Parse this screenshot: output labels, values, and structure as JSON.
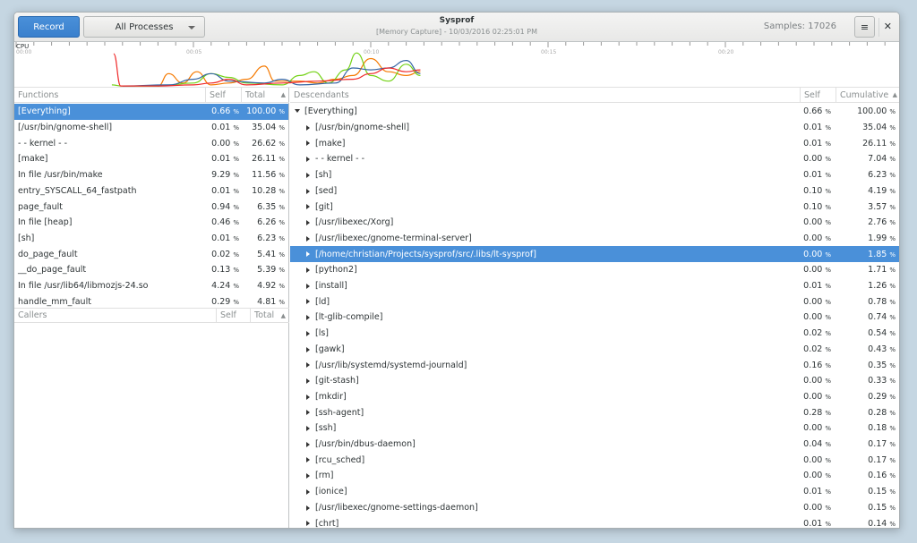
{
  "header": {
    "record_label": "Record",
    "process_selector": "All Processes",
    "title": "Sysprof",
    "subtitle": "[Memory Capture] - 10/03/2016 02:25:01 PM",
    "samples": "Samples: 17026",
    "menu_icon": "hamburger-menu-icon",
    "close_icon": "close-icon"
  },
  "chart_data": {
    "type": "line",
    "title": "CPU",
    "xlabel": "",
    "ylabel": "",
    "x_ticks": [
      "00:00",
      "00:05",
      "00:10",
      "00:15",
      "00:20"
    ],
    "xlim": [
      0,
      25
    ],
    "ylim": [
      0,
      100
    ],
    "grid": false,
    "series": [
      {
        "color": "#f57900",
        "points": [
          [
            4,
            2
          ],
          [
            4.3,
            35
          ],
          [
            4.7,
            10
          ],
          [
            5.1,
            40
          ],
          [
            5.5,
            5
          ],
          [
            6,
            10
          ],
          [
            6.5,
            20
          ],
          [
            7,
            55
          ],
          [
            7.3,
            15
          ],
          [
            8,
            15
          ],
          [
            8.5,
            10
          ],
          [
            9,
            20
          ],
          [
            9.5,
            30
          ],
          [
            10,
            75
          ],
          [
            10.5,
            40
          ],
          [
            11,
            30
          ],
          [
            11.4,
            40
          ]
        ]
      },
      {
        "color": "#73d216",
        "points": [
          [
            2.7,
            5
          ],
          [
            3,
            2
          ],
          [
            4,
            2
          ],
          [
            5,
            10
          ],
          [
            5.5,
            35
          ],
          [
            6,
            25
          ],
          [
            6.5,
            10
          ],
          [
            7.5,
            5
          ],
          [
            8,
            30
          ],
          [
            8.4,
            40
          ],
          [
            8.8,
            10
          ],
          [
            9.3,
            45
          ],
          [
            9.6,
            90
          ],
          [
            10,
            30
          ],
          [
            10.5,
            15
          ],
          [
            11,
            60
          ],
          [
            11.4,
            30
          ]
        ]
      },
      {
        "color": "#3465a4",
        "points": [
          [
            3,
            2
          ],
          [
            4.3,
            5
          ],
          [
            5,
            20
          ],
          [
            5.5,
            35
          ],
          [
            6,
            15
          ],
          [
            7,
            10
          ],
          [
            7.5,
            20
          ],
          [
            8,
            5
          ],
          [
            9,
            10
          ],
          [
            9.5,
            50
          ],
          [
            10,
            45
          ],
          [
            10.5,
            50
          ],
          [
            11,
            70
          ],
          [
            11.4,
            35
          ]
        ]
      },
      {
        "color": "#ef2929",
        "points": [
          [
            2.75,
            88
          ],
          [
            2.95,
            2
          ],
          [
            4,
            2
          ],
          [
            5,
            5
          ],
          [
            5.5,
            10
          ],
          [
            6,
            20
          ],
          [
            6.5,
            5
          ],
          [
            7.5,
            10
          ],
          [
            8.5,
            15
          ],
          [
            9.5,
            20
          ],
          [
            10,
            35
          ],
          [
            10.5,
            50
          ],
          [
            11,
            40
          ],
          [
            11.4,
            45
          ]
        ]
      }
    ]
  },
  "functions": {
    "headers": {
      "name": "Functions",
      "self": "Self",
      "total": "Total"
    },
    "selected": 0,
    "rows": [
      {
        "name": "[Everything]",
        "self": "0.66",
        "total": "100.00"
      },
      {
        "name": "[/usr/bin/gnome-shell]",
        "self": "0.01",
        "total": "35.04"
      },
      {
        "name": "- - kernel - -",
        "self": "0.00",
        "total": "26.62"
      },
      {
        "name": "[make]",
        "self": "0.01",
        "total": "26.11"
      },
      {
        "name": "In file /usr/bin/make",
        "self": "9.29",
        "total": "11.56"
      },
      {
        "name": "entry_SYSCALL_64_fastpath",
        "self": "0.01",
        "total": "10.28"
      },
      {
        "name": "page_fault",
        "self": "0.94",
        "total": "6.35"
      },
      {
        "name": "In file [heap]",
        "self": "0.46",
        "total": "6.26"
      },
      {
        "name": "[sh]",
        "self": "0.01",
        "total": "6.23"
      },
      {
        "name": "do_page_fault",
        "self": "0.02",
        "total": "5.41"
      },
      {
        "name": "__do_page_fault",
        "self": "0.13",
        "total": "5.39"
      },
      {
        "name": "In file /usr/lib64/libmozjs-24.so",
        "self": "4.24",
        "total": "4.92"
      },
      {
        "name": "handle_mm_fault",
        "self": "0.29",
        "total": "4.81"
      }
    ]
  },
  "callers": {
    "headers": {
      "name": "Callers",
      "self": "Self",
      "total": "Total"
    }
  },
  "descendants": {
    "headers": {
      "name": "Descendants",
      "self": "Self",
      "total": "Cumulative"
    },
    "selected": 9,
    "rows": [
      {
        "name": "[Everything]",
        "self": "0.66",
        "total": "100.00",
        "root": true
      },
      {
        "name": "[/usr/bin/gnome-shell]",
        "self": "0.01",
        "total": "35.04"
      },
      {
        "name": "[make]",
        "self": "0.01",
        "total": "26.11"
      },
      {
        "name": "- - kernel - -",
        "self": "0.00",
        "total": "7.04"
      },
      {
        "name": "[sh]",
        "self": "0.01",
        "total": "6.23"
      },
      {
        "name": "[sed]",
        "self": "0.10",
        "total": "4.19"
      },
      {
        "name": "[git]",
        "self": "0.10",
        "total": "3.57"
      },
      {
        "name": "[/usr/libexec/Xorg]",
        "self": "0.00",
        "total": "2.76"
      },
      {
        "name": "[/usr/libexec/gnome-terminal-server]",
        "self": "0.00",
        "total": "1.99"
      },
      {
        "name": "[/home/christian/Projects/sysprof/src/.libs/lt-sysprof]",
        "self": "0.00",
        "total": "1.85"
      },
      {
        "name": "[python2]",
        "self": "0.00",
        "total": "1.71"
      },
      {
        "name": "[install]",
        "self": "0.01",
        "total": "1.26"
      },
      {
        "name": "[ld]",
        "self": "0.00",
        "total": "0.78"
      },
      {
        "name": "[lt-glib-compile]",
        "self": "0.00",
        "total": "0.74"
      },
      {
        "name": "[ls]",
        "self": "0.02",
        "total": "0.54"
      },
      {
        "name": "[gawk]",
        "self": "0.02",
        "total": "0.43"
      },
      {
        "name": "[/usr/lib/systemd/systemd-journald]",
        "self": "0.16",
        "total": "0.35"
      },
      {
        "name": "[git-stash]",
        "self": "0.00",
        "total": "0.33"
      },
      {
        "name": "[mkdir]",
        "self": "0.00",
        "total": "0.29"
      },
      {
        "name": "[ssh-agent]",
        "self": "0.28",
        "total": "0.28"
      },
      {
        "name": "[ssh]",
        "self": "0.00",
        "total": "0.18"
      },
      {
        "name": "[/usr/bin/dbus-daemon]",
        "self": "0.04",
        "total": "0.17"
      },
      {
        "name": "[rcu_sched]",
        "self": "0.00",
        "total": "0.17"
      },
      {
        "name": "[rm]",
        "self": "0.00",
        "total": "0.16"
      },
      {
        "name": "[ionice]",
        "self": "0.01",
        "total": "0.15"
      },
      {
        "name": "[/usr/libexec/gnome-settings-daemon]",
        "self": "0.00",
        "total": "0.15"
      },
      {
        "name": "[chrt]",
        "self": "0.01",
        "total": "0.14"
      }
    ]
  },
  "percent_sign": "%"
}
